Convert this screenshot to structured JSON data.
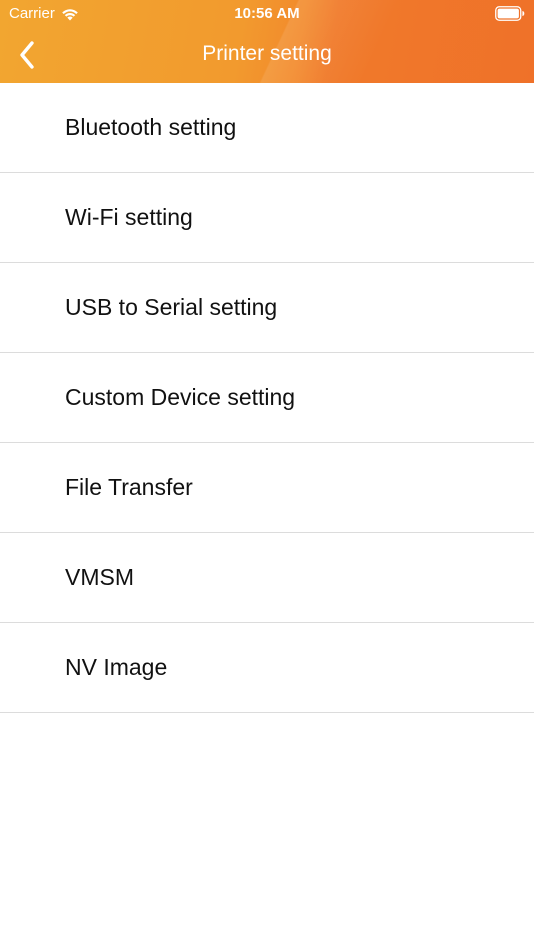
{
  "status_bar": {
    "carrier": "Carrier",
    "time": "10:56 AM",
    "wifi_icon": "wifi-icon",
    "battery_icon": "battery-icon"
  },
  "nav": {
    "title": "Printer setting",
    "back_icon": "chevron-left-icon"
  },
  "colors": {
    "header_start": "#f2a630",
    "header_end": "#ef7129",
    "separator": "#dcdcdc",
    "text": "#111111"
  },
  "menu": {
    "items": [
      {
        "label": "Bluetooth setting"
      },
      {
        "label": "Wi-Fi setting"
      },
      {
        "label": "USB to Serial setting"
      },
      {
        "label": "Custom Device setting"
      },
      {
        "label": "File Transfer"
      },
      {
        "label": "VMSM"
      },
      {
        "label": "NV Image"
      }
    ]
  }
}
